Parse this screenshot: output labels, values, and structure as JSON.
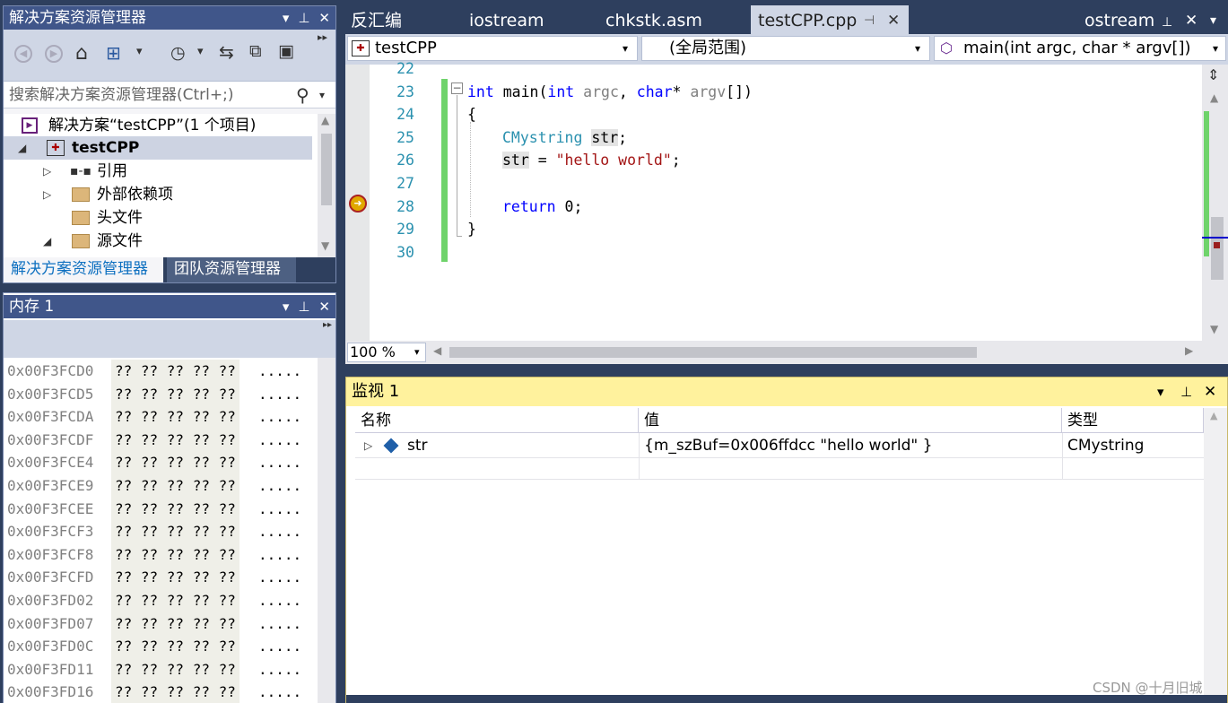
{
  "solution_explorer": {
    "title": "解决方案资源管理器",
    "search_placeholder": "搜索解决方案资源管理器(Ctrl+;)",
    "tree": {
      "solution": "解决方案“testCPP”(1 个项目)",
      "project": "testCPP",
      "references": "引用",
      "external_deps": "外部依赖项",
      "headers": "头文件",
      "sources": "源文件"
    },
    "bottom_tabs": [
      "解决方案资源管理器",
      "团队资源管理器"
    ]
  },
  "memory": {
    "title": "内存 1",
    "rows": [
      {
        "addr": "0x00F3FCD0",
        "bytes": "?? ?? ?? ?? ??",
        "chars": "....."
      },
      {
        "addr": "0x00F3FCD5",
        "bytes": "?? ?? ?? ?? ??",
        "chars": "....."
      },
      {
        "addr": "0x00F3FCDA",
        "bytes": "?? ?? ?? ?? ??",
        "chars": "....."
      },
      {
        "addr": "0x00F3FCDF",
        "bytes": "?? ?? ?? ?? ??",
        "chars": "....."
      },
      {
        "addr": "0x00F3FCE4",
        "bytes": "?? ?? ?? ?? ??",
        "chars": "....."
      },
      {
        "addr": "0x00F3FCE9",
        "bytes": "?? ?? ?? ?? ??",
        "chars": "....."
      },
      {
        "addr": "0x00F3FCEE",
        "bytes": "?? ?? ?? ?? ??",
        "chars": "....."
      },
      {
        "addr": "0x00F3FCF3",
        "bytes": "?? ?? ?? ?? ??",
        "chars": "....."
      },
      {
        "addr": "0x00F3FCF8",
        "bytes": "?? ?? ?? ?? ??",
        "chars": "....."
      },
      {
        "addr": "0x00F3FCFD",
        "bytes": "?? ?? ?? ?? ??",
        "chars": "....."
      },
      {
        "addr": "0x00F3FD02",
        "bytes": "?? ?? ?? ?? ??",
        "chars": "....."
      },
      {
        "addr": "0x00F3FD07",
        "bytes": "?? ?? ?? ?? ??",
        "chars": "....."
      },
      {
        "addr": "0x00F3FD0C",
        "bytes": "?? ?? ?? ?? ??",
        "chars": "....."
      },
      {
        "addr": "0x00F3FD11",
        "bytes": "?? ?? ?? ?? ??",
        "chars": "....."
      },
      {
        "addr": "0x00F3FD16",
        "bytes": "?? ?? ?? ?? ??",
        "chars": "....."
      }
    ]
  },
  "editor": {
    "tabs": [
      "反汇编",
      "iostream",
      "chkstk.asm",
      "testCPP.cpp",
      "ostream"
    ],
    "active_tab": "testCPP.cpp",
    "nav": {
      "project": "testCPP",
      "scope": "(全局范围)",
      "member": "main(int argc, char * argv[])"
    },
    "line_numbers": [
      "22",
      "23",
      "24",
      "25",
      "26",
      "27",
      "28",
      "29",
      "30"
    ],
    "code": {
      "l23_kw": "int",
      "l23_fn": " main(",
      "l23_kw2": "int",
      "l23_p1": " argc",
      "l23_sep": ", ",
      "l23_kw3": "char",
      "l23_star": "* ",
      "l23_p2": "argv",
      "l23_end": "[])",
      "l24": "{",
      "l25_type": "CMystring",
      "l25_var": "str",
      "l25_end": ";",
      "l26_var": "str",
      "l26_op": " = ",
      "l26_str": "\"hello world\"",
      "l26_end": ";",
      "l28_kw": "return",
      "l28_rest": " 0;",
      "l29": "}"
    },
    "zoom": "100 %"
  },
  "watch": {
    "title": "监视 1",
    "columns": [
      "名称",
      "值",
      "类型"
    ],
    "rows": [
      {
        "name": "str",
        "value": "{m_szBuf=0x006ffdcc \"hello world\" }",
        "type": "CMystring"
      }
    ]
  },
  "watermark": "CSDN @十月旧城"
}
